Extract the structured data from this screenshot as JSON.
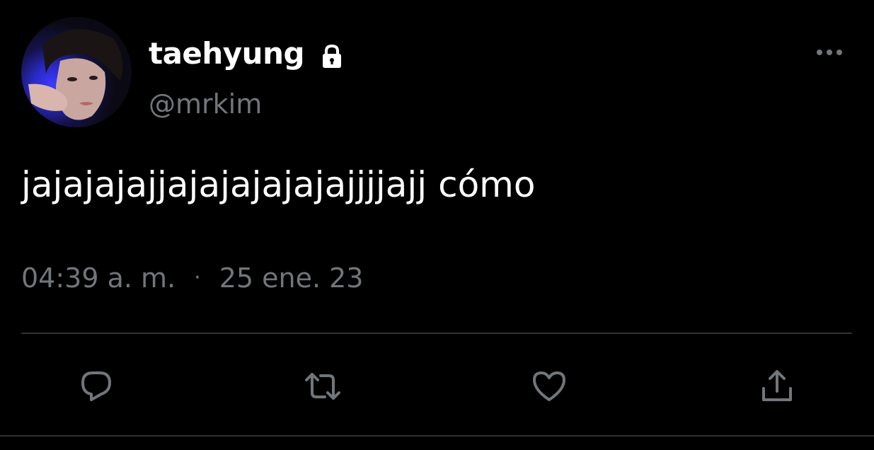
{
  "author": {
    "display_name": "taehyung",
    "handle": "@mrkim",
    "protected_icon": "lock-icon",
    "avatar": "profile-photo"
  },
  "tweet": {
    "text": "jajajajajjajajajajajajjjjajj cómo",
    "time": "04:39 a. m.",
    "separator": "·",
    "date": "25 ene. 23"
  },
  "actions": {
    "reply_icon": "reply-icon",
    "retweet_icon": "retweet-icon",
    "like_icon": "heart-icon",
    "share_icon": "share-icon",
    "more_icon": "more-icon"
  },
  "colors": {
    "background": "#000000",
    "primary_text": "#ffffff",
    "secondary_text": "#71767b",
    "divider": "#2f3336"
  }
}
